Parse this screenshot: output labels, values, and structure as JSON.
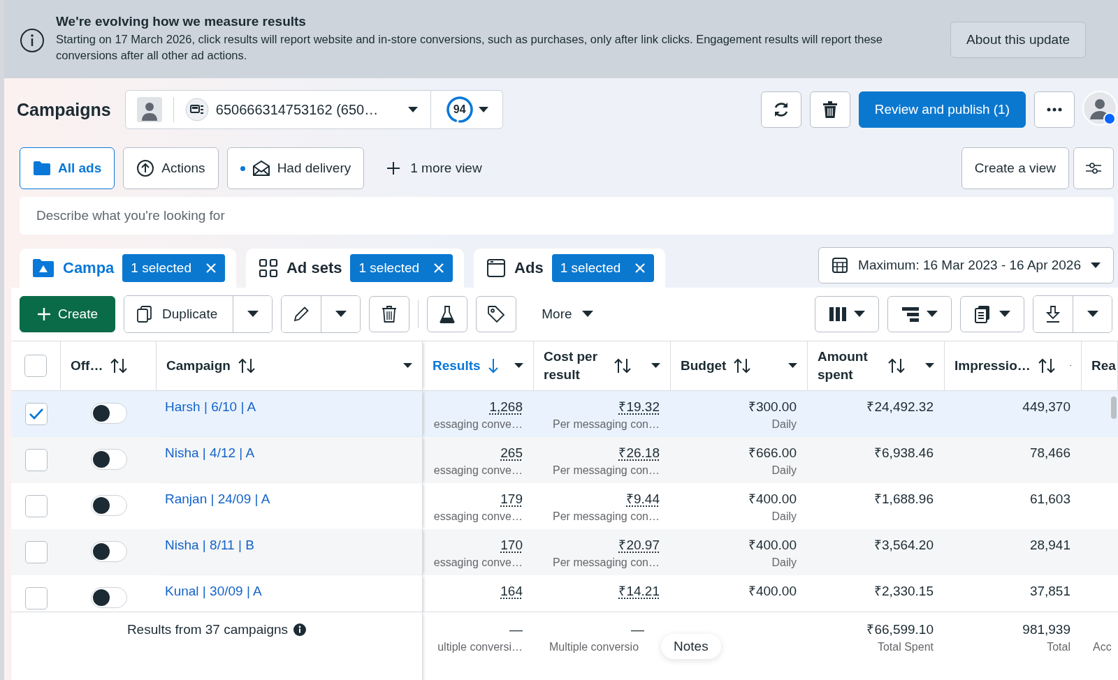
{
  "banner": {
    "title": "We're evolving how we measure results",
    "text": "Starting on 17 March 2026, click results will report website and in-store conversions, such as purchases, only after link clicks. Engagement results will report these conversions after all other ad actions.",
    "button": "About this update"
  },
  "header": {
    "title": "Campaigns",
    "account": "650666314753162 (650…",
    "score": "94",
    "score_ring": {
      "level": 0.94
    },
    "publish_button": "Review and publish (1)"
  },
  "views": [
    {
      "label": "All ads",
      "selected": true
    },
    {
      "label": "Actions",
      "selected": false
    },
    {
      "label": "Had delivery",
      "selected": false
    }
  ],
  "more_views": "1 more view",
  "create_view": "Create a view",
  "search": {
    "placeholder": "Describe what you're looking for"
  },
  "levels": [
    {
      "label": "Campa",
      "badge": "1 selected",
      "selected": true
    },
    {
      "label": "Ad sets",
      "badge": "1 selected",
      "selected": false
    },
    {
      "label": "Ads",
      "badge": "1 selected",
      "selected": false
    }
  ],
  "date_range": "Maximum: 16 Mar 2023 - 16 Apr 2026",
  "toolbar": {
    "create": "Create",
    "duplicate": "Duplicate",
    "more": "More"
  },
  "table": {
    "all_checked": false,
    "columns": [
      {
        "label": "Off…",
        "sorted": false
      },
      {
        "label": "Campaign",
        "sorted": false
      },
      {
        "label": "Results",
        "sorted": true
      },
      {
        "label": "Cost per result",
        "sorted": false
      },
      {
        "label": "Budget",
        "sorted": false
      },
      {
        "label": "Amount spent",
        "sorted": false
      },
      {
        "label": "Impressio…",
        "sorted": false
      },
      {
        "label": "Rea",
        "sorted": false
      }
    ],
    "rows": [
      {
        "selected": true,
        "on": false,
        "campaign": "Harsh | 6/10 | A",
        "results": "1,268",
        "results_sub": "essaging conve…",
        "cost": "₹19.32",
        "cost_sub": "Per messaging con…",
        "budget": "₹300.00",
        "budget_sub": "Daily",
        "spent": "₹24,492.32",
        "impressions": "449,370"
      },
      {
        "selected": false,
        "on": false,
        "campaign": "Nisha | 4/12 | A",
        "results": "265",
        "results_sub": "essaging conve…",
        "cost": "₹26.18",
        "cost_sub": "Per messaging con…",
        "budget": "₹666.00",
        "budget_sub": "Daily",
        "spent": "₹6,938.46",
        "impressions": "78,466"
      },
      {
        "selected": false,
        "on": false,
        "campaign": "Ranjan | 24/09 | A",
        "results": "179",
        "results_sub": "essaging conve…",
        "cost": "₹9.44",
        "cost_sub": "Per messaging con…",
        "budget": "₹400.00",
        "budget_sub": "Daily",
        "spent": "₹1,688.96",
        "impressions": "61,603"
      },
      {
        "selected": false,
        "on": false,
        "campaign": "Nisha | 8/11 | B",
        "results": "170",
        "results_sub": "essaging conve…",
        "cost": "₹20.97",
        "cost_sub": "Per messaging con…",
        "budget": "₹400.00",
        "budget_sub": "Daily",
        "spent": "₹3,564.20",
        "impressions": "28,941"
      },
      {
        "selected": false,
        "on": false,
        "campaign": "Kunal | 30/09 | A",
        "results": "164",
        "cost": "₹14.21",
        "budget": "₹400.00",
        "spent": "₹2,330.15",
        "impressions": "37,851"
      }
    ],
    "footer": {
      "label": "Results from 37 campaigns",
      "results": "—",
      "results_sub": "ultiple conversi…",
      "cost": "—",
      "cost_sub": "Multiple conversio",
      "spent": "₹66,599.10",
      "spent_sub": "Total Spent",
      "impressions": "981,939",
      "impressions_sub": "Total",
      "reach_sub": "Acc"
    }
  },
  "tooltip": "Notes"
}
